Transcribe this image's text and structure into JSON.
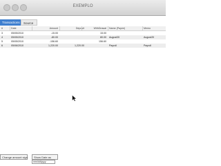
{
  "window": {
    "title": "EXEMPLO"
  },
  "tabs": [
    {
      "label": "Transactions",
      "active": true
    },
    {
      "label": "Source",
      "active": false
    }
  ],
  "table": {
    "columns": [
      "#",
      "Date",
      "Amount",
      "Deposit",
      "WithDrawal",
      "Name (Payee)",
      "Memo"
    ],
    "rows": [
      [
        "3",
        "05/05/2010",
        "-15.00",
        "",
        "15.00",
        "",
        ""
      ],
      [
        "4",
        "05/05/2010",
        "-80.00",
        "",
        "80.00",
        "August20",
        "August20"
      ],
      [
        "5",
        "05/05/2010",
        "-156.60",
        "",
        "156.60",
        "",
        ""
      ],
      [
        "6",
        "05/06/2010",
        "1,220.00",
        "1,220.00",
        "",
        "Payroll",
        "Payroll"
      ]
    ]
  },
  "footer": {
    "button1_label": "Change amount sign",
    "button2_label": "Show Date as",
    "date_format_value": "mm/dd/yyyy"
  },
  "colors": {
    "accent": "#3f7fcf",
    "row_alt": "#ededed"
  },
  "icons": {
    "cursor": "arrow-cursor-icon"
  }
}
